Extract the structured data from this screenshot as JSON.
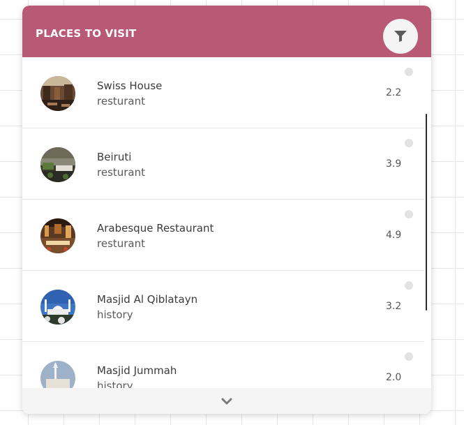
{
  "header": {
    "title": "PLACES TO VISIT",
    "filter_icon": "filter-icon",
    "accent_color": "#b85a76"
  },
  "places": [
    {
      "name": "Swiss House",
      "category": "resturant",
      "rating": "2.2"
    },
    {
      "name": "Beiruti",
      "category": "resturant",
      "rating": "3.9"
    },
    {
      "name": "Arabesque Restaurant",
      "category": "resturant",
      "rating": "4.9"
    },
    {
      "name": "Masjid Al Qiblatayn",
      "category": "history",
      "rating": "3.2"
    },
    {
      "name": "Masjid Jummah",
      "category": "history",
      "rating": "2.0"
    }
  ],
  "footer": {
    "expand_icon": "chevron-down-icon"
  }
}
